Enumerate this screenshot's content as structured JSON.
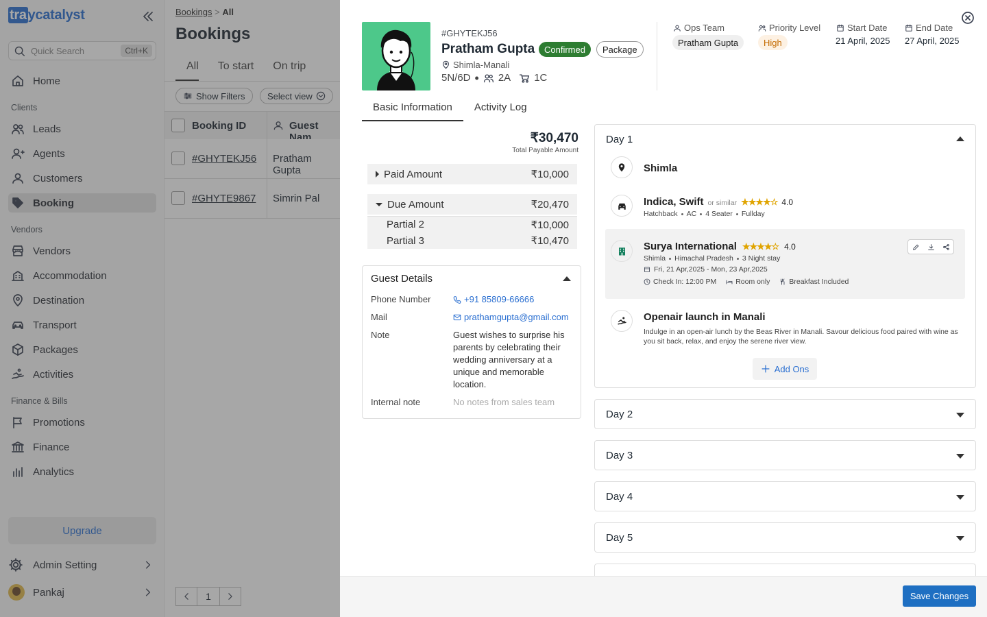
{
  "sidebar": {
    "logo_pre": "tra",
    "logo_rest": "ycatalyst",
    "search_placeholder": "Quick Search",
    "search_shortcut": "Ctrl+K",
    "home": "Home",
    "group_clients": "Clients",
    "leads": "Leads",
    "agents": "Agents",
    "customers": "Customers",
    "booking": "Booking",
    "group_vendors": "Vendors",
    "vendors": "Vendors",
    "accommodation": "Accommodation",
    "destination": "Destination",
    "transport": "Transport",
    "packages": "Packages",
    "activities": "Activities",
    "group_finance": "Finance & Bills",
    "promotions": "Promotions",
    "finance": "Finance",
    "analytics": "Analytics",
    "upgrade": "Upgrade",
    "admin_setting": "Admin Setting",
    "user": "Pankaj"
  },
  "main": {
    "breadcrumb_root": "Bookings",
    "breadcrumb_sep": ">",
    "breadcrumb_current": "All",
    "title": "Bookings",
    "tabs": [
      "All",
      "To start",
      "On trip"
    ],
    "show_filters": "Show Filters",
    "select_view": "Select view",
    "col_booking_id": "Booking ID",
    "col_guest": "Guest Nam",
    "rows": [
      {
        "id": "#GHYTEKJ56",
        "guest": "Pratham Gupta"
      },
      {
        "id": "#GHYTE9867",
        "guest": "Simrin Pal"
      }
    ],
    "page": "1"
  },
  "drawer": {
    "booking_id": "#GHYTEKJ56",
    "guest_name": "Pratham Gupta",
    "status": "Confirmed",
    "type": "Package",
    "location": "Shimla-Manali",
    "duration": "5N/6D",
    "adults": "2A",
    "children": "1C",
    "ops_team_label": "Ops Team",
    "ops_team_value": "Pratham Gupta",
    "priority_label": "Priority Level",
    "priority_value": "High",
    "start_label": "Start Date",
    "start_value": "21 April, 2025",
    "end_label": "End Date",
    "end_value": "27 April, 2025",
    "tabs": [
      "Basic Information",
      "Activity Log"
    ],
    "total_amount": "₹30,470",
    "total_label": "Total Payable Amount",
    "paid_label": "Paid Amount",
    "paid_value": "₹10,000",
    "due_label": "Due Amount",
    "due_value": "₹20,470",
    "partials": [
      {
        "label": "Partial 2",
        "value": "₹10,000"
      },
      {
        "label": "Partial 3",
        "value": "₹10,470"
      }
    ],
    "guest_details": {
      "title": "Guest Details",
      "phone_label": "Phone Number",
      "phone_value": "+91 85809-66666",
      "mail_label": "Mail",
      "mail_value": "prathamgupta@gmail.com",
      "note_label": "Note",
      "note_value": "Guest wishes to surprise his parents by celebrating their wedding anniversary at a unique and memorable location.",
      "internal_label": "Internal note",
      "internal_value": "No notes from sales team"
    },
    "day1": {
      "title": "Day 1",
      "city": "Shimla",
      "car": {
        "name": "Indica, Swift",
        "similar": "or similar",
        "rating": "4.0",
        "stars": 4,
        "specs": [
          "Hatchback",
          "AC",
          "4 Seater",
          "Fullday"
        ]
      },
      "hotel": {
        "name": "Surya International",
        "rating": "4.0",
        "stars": 4,
        "place": [
          "Shimla",
          "Himachal Pradesh",
          "3 Night stay"
        ],
        "dates": "Fri, 21 Apr,2025 - Mon, 23 Apr,2025",
        "checkin": "Check In: 12:00 PM",
        "room": "Room only",
        "meal": "Breakfast Included"
      },
      "activity": {
        "name": "Openair launch in Manali",
        "desc": "Indulge in an open-air lunch by the Beas River in Manali. Savour delicious food paired with wine as you sit back, relax, and enjoy the serene river view."
      },
      "add_ons": "Add Ons"
    },
    "days": [
      "Day 2",
      "Day 3",
      "Day 4",
      "Day 5"
    ],
    "save": "Save Changes"
  },
  "colors": {
    "accent": "#1e6fc2",
    "confirmed": "#2e7d32",
    "priority_high": "#c46a00",
    "photo_bg": "#4dc88a"
  }
}
